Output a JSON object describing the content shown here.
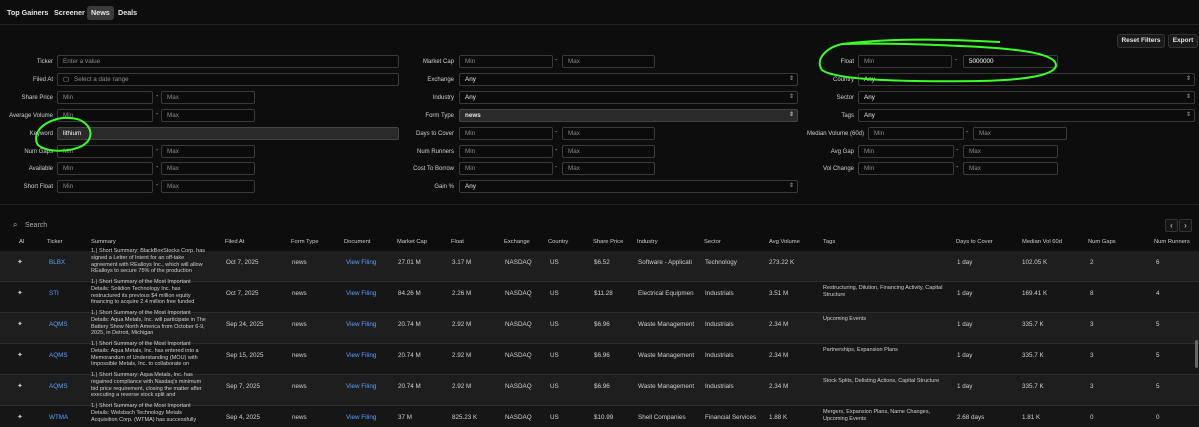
{
  "tabs": [
    "Top Gainers",
    "Screener",
    "News",
    "Deals"
  ],
  "active_tab": "News",
  "buttons": {
    "reset": "Reset Filters",
    "export": "Export"
  },
  "filters": {
    "ticker": {
      "label": "Ticker",
      "placeholder": "Enter a value"
    },
    "filed_at": {
      "label": "Filed At",
      "placeholder": "Select a date range"
    },
    "share_price": {
      "label": "Share Price",
      "min": "Min",
      "max": "Max"
    },
    "average_volume": {
      "label": "Average Volume",
      "min": "Min",
      "max": "Max"
    },
    "keyword": {
      "label": "Keyword",
      "value": "lithium"
    },
    "num_gaps": {
      "label": "Num Gaps",
      "min": "Min",
      "max": "Max"
    },
    "available": {
      "label": "Available",
      "min": "Min",
      "max": "Max"
    },
    "short_float": {
      "label": "Short Float",
      "min": "Min",
      "max": "Max"
    },
    "market_cap": {
      "label": "Market Cap",
      "min": "Min",
      "max": "Max"
    },
    "exchange": {
      "label": "Exchange",
      "value": "Any"
    },
    "industry": {
      "label": "Industry",
      "value": "Any"
    },
    "form_type": {
      "label": "Form Type",
      "value": "news"
    },
    "days_to_cover": {
      "label": "Days to Cover",
      "min": "Min",
      "max": "Max"
    },
    "num_runners": {
      "label": "Num Runners",
      "min": "Min",
      "max": "Max"
    },
    "cost_to_borrow": {
      "label": "Cost To Borrow",
      "min": "Min",
      "max": "Max"
    },
    "gain_pct": {
      "label": "Gain %",
      "value": "Any"
    },
    "float": {
      "label": "Float",
      "min": "Min",
      "max": "5000000"
    },
    "country": {
      "label": "Country",
      "value": "Any"
    },
    "sector": {
      "label": "Sector",
      "value": "Any"
    },
    "tags": {
      "label": "Tags",
      "value": "Any"
    },
    "median_volume": {
      "label": "Median Volume (60d)",
      "min": "Min",
      "max": "Max"
    },
    "avg_gap": {
      "label": "Avg Gap",
      "min": "Min",
      "max": "Max"
    },
    "vol_change": {
      "label": "Vol Change",
      "min": "Min",
      "max": "Max"
    }
  },
  "search": {
    "placeholder": "Search"
  },
  "columns": [
    "AI",
    "Ticker",
    "Summary",
    "Filed At",
    "Form Type",
    "Document",
    "Market Cap",
    "Float",
    "Exchange",
    "Country",
    "Share Price",
    "Industry",
    "Sector",
    "Avg Volume",
    "Tags",
    "Days to Cover",
    "Median Vol 60d",
    "Num Gaps",
    "Num Runners"
  ],
  "rows": [
    {
      "ticker": "BLBX",
      "summary": "1.) Short Summary: BlackBoxStocks Corp. has signed a Letter of Intent for an off-take agreement with REalloys Inc., which will allow REalloys to secure 75% of the production",
      "filed_at": "Oct 7, 2025",
      "form_type": "news",
      "document": "View Filing",
      "market_cap": "27.01 M",
      "float": "3.17 M",
      "exchange": "NASDAQ",
      "country": "US",
      "share_price": "$6.52",
      "industry": "Software - Applicati",
      "sector": "Technology",
      "avg_volume": "273.22 K",
      "tags": "",
      "days_to_cover": "1 day",
      "median_vol": "102.05 K",
      "num_gaps": "2",
      "num_runners": "6"
    },
    {
      "ticker": "STI",
      "summary": "1.) Short Summary of the Most Important Details: Solidion Technology Inc. has restructured its previous $4 million equity financing to acquire 2.4 million free funded",
      "filed_at": "Oct 7, 2025",
      "form_type": "news",
      "document": "View Filing",
      "market_cap": "84.26 M",
      "float": "2.26 M",
      "exchange": "NASDAQ",
      "country": "US",
      "share_price": "$11.28",
      "industry": "Electrical Equipmen",
      "sector": "Industrials",
      "avg_volume": "3.51 M",
      "tags": "Restructuring, Dilution, Financing Activity, Capital Structure",
      "days_to_cover": "1 day",
      "median_vol": "169.41 K",
      "num_gaps": "8",
      "num_runners": "4"
    },
    {
      "ticker": "AQMS",
      "summary": "1.) Short Summary of the Most Important Details: Aqua Metals, Inc. will participate in The Battery Show North America from October 6-9, 2025, in Detroit, Michigan",
      "filed_at": "Sep 24, 2025",
      "form_type": "news",
      "document": "View Filing",
      "market_cap": "20.74 M",
      "float": "2.92 M",
      "exchange": "NASDAQ",
      "country": "US",
      "share_price": "$6.96",
      "industry": "Waste Management",
      "sector": "Industrials",
      "avg_volume": "2.34 M",
      "tags": "Upcoming Events",
      "days_to_cover": "1 day",
      "median_vol": "335.7 K",
      "num_gaps": "3",
      "num_runners": "5"
    },
    {
      "ticker": "AQMS",
      "summary": "1.) Short Summary of the Most Important Details: Aqua Metals, Inc. has entered into a Memorandum of Understanding (MOU) with Impossible Metals, Inc. to collaborate on",
      "filed_at": "Sep 15, 2025",
      "form_type": "news",
      "document": "View Filing",
      "market_cap": "20.74 M",
      "float": "2.92 M",
      "exchange": "NASDAQ",
      "country": "US",
      "share_price": "$6.96",
      "industry": "Waste Management",
      "sector": "Industrials",
      "avg_volume": "2.34 M",
      "tags": "Partnerships, Expansion Plans",
      "days_to_cover": "1 day",
      "median_vol": "335.7 K",
      "num_gaps": "3",
      "num_runners": "5"
    },
    {
      "ticker": "AQMS",
      "summary": "1.) Short Summary: Aqua Metals, Inc. has regained compliance with Nasdaq's minimum bid price requirement, closing the matter after executing a reverse stock split and",
      "filed_at": "Sep 7, 2025",
      "form_type": "news",
      "document": "View Filing",
      "market_cap": "20.74 M",
      "float": "2.92 M",
      "exchange": "NASDAQ",
      "country": "US",
      "share_price": "$6.96",
      "industry": "Waste Management",
      "sector": "Industrials",
      "avg_volume": "2.34 M",
      "tags": "Stock Splits, Delisting Actions, Capital Structure",
      "days_to_cover": "1 day",
      "median_vol": "335.7 K",
      "num_gaps": "3",
      "num_runners": "5"
    },
    {
      "ticker": "WTMA",
      "summary": "1.) Short Summary of the Most Important Details: Welsbach Technology Metals Acquisition Corp. (WTMA) has successfully",
      "filed_at": "Sep 4, 2025",
      "form_type": "news",
      "document": "View Filing",
      "market_cap": "37 M",
      "float": "825.23 K",
      "exchange": "NASDAQ",
      "country": "US",
      "share_price": "$10.99",
      "industry": "Shell Companies",
      "sector": "Financial Services",
      "avg_volume": "1.88 K",
      "tags": "Mergers, Expansion Plans, Name Changes, Upcoming Events",
      "days_to_cover": "2.68 days",
      "median_vol": "1.81 K",
      "num_gaps": "0",
      "num_runners": "0"
    }
  ],
  "colors": {
    "accent_link": "#5aa0ff",
    "annotation": "#3cff2a",
    "bg": "#0d0d0d"
  }
}
